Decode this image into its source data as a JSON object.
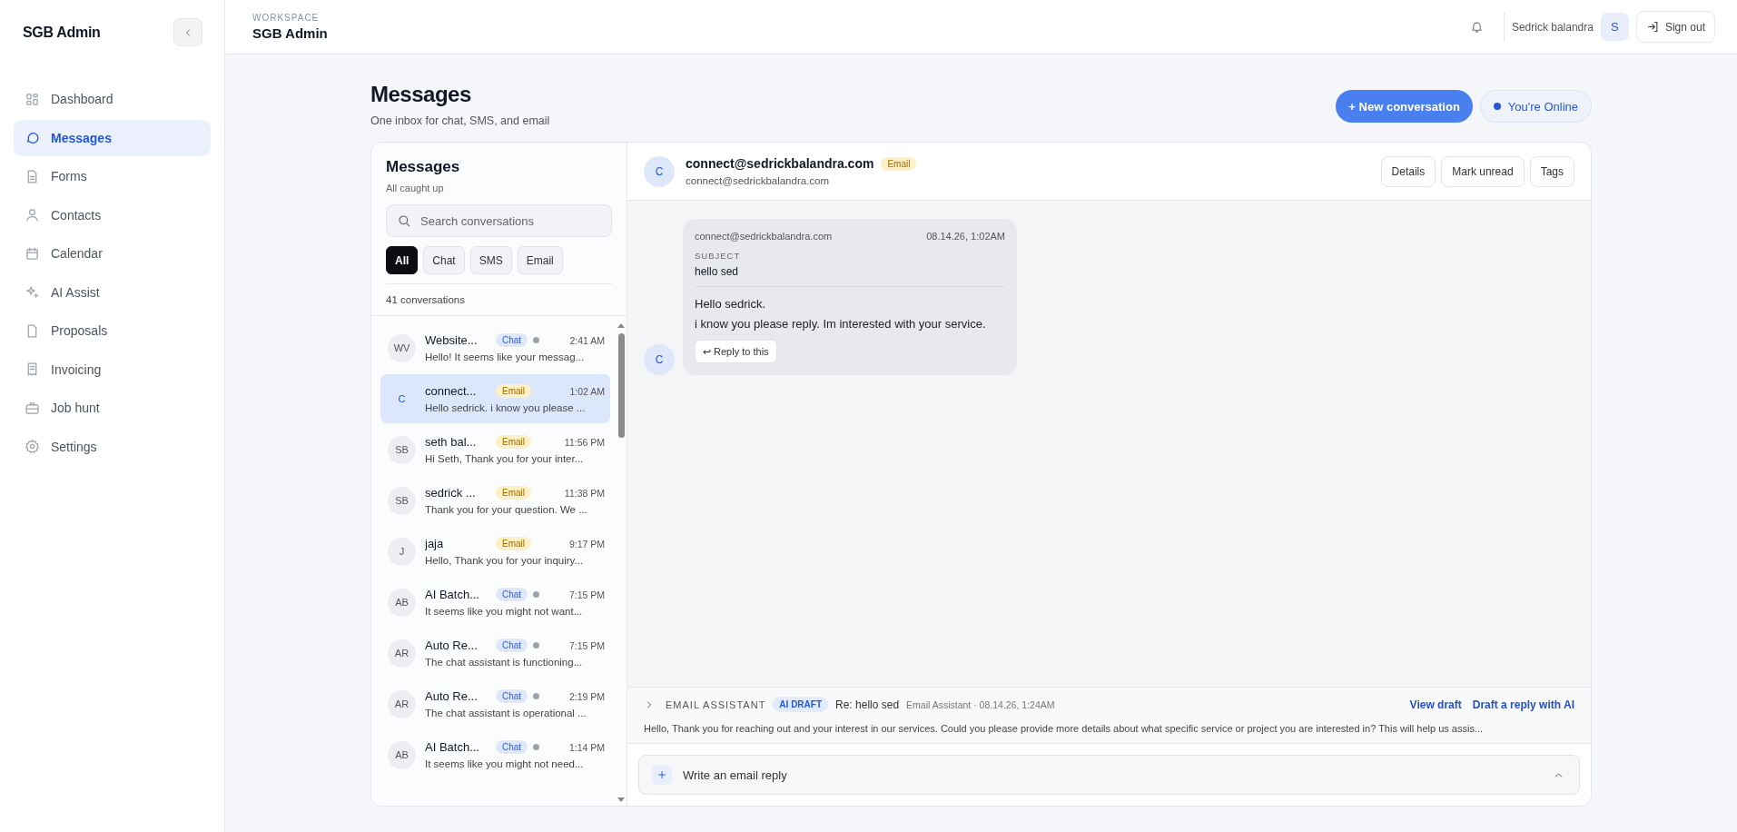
{
  "sidebar": {
    "title": "SGB Admin",
    "items": [
      {
        "label": "Dashboard",
        "selected": false
      },
      {
        "label": "Messages",
        "selected": true
      },
      {
        "label": "Forms",
        "selected": false
      },
      {
        "label": "Contacts",
        "selected": false
      },
      {
        "label": "Calendar",
        "selected": false
      },
      {
        "label": "AI Assist",
        "selected": false
      },
      {
        "label": "Proposals",
        "selected": false
      },
      {
        "label": "Invoicing",
        "selected": false
      },
      {
        "label": "Job hunt",
        "selected": false
      },
      {
        "label": "Settings",
        "selected": false
      }
    ]
  },
  "header": {
    "eyebrow": "WORKSPACE",
    "title": "SGB Admin",
    "user_name": "Sedrick balandra",
    "user_initial": "S",
    "sign_out": "Sign out"
  },
  "page": {
    "title": "Messages",
    "subtitle": "One inbox for chat, SMS, and email",
    "new_button": "+ New conversation",
    "status": "You're Online"
  },
  "inbox": {
    "title": "Messages",
    "subtitle": "All caught up",
    "search": {
      "placeholder": "Search conversations"
    },
    "filters": [
      {
        "label": "All",
        "selected": true
      },
      {
        "label": "Chat",
        "selected": false
      },
      {
        "label": "SMS",
        "selected": false
      },
      {
        "label": "Email",
        "selected": false
      }
    ],
    "count": "41 conversations",
    "conversations": [
      {
        "initials": "WV",
        "name": "Website...",
        "kind": "chat",
        "tag": "Chat",
        "unread": true,
        "time": "2:41 AM",
        "preview": "Hello! It seems like your messag...",
        "selected": false
      },
      {
        "initials": "C",
        "name": "connect...",
        "kind": "email",
        "tag": "Email",
        "unread": false,
        "time": "1:02 AM",
        "preview": "Hello sedrick. i know you please ...",
        "selected": true
      },
      {
        "initials": "SB",
        "name": "seth bal...",
        "kind": "email",
        "tag": "Email",
        "unread": false,
        "time": "11:56 PM",
        "preview": "Hi Seth, Thank you for your inter...",
        "selected": false
      },
      {
        "initials": "SB",
        "name": "sedrick ...",
        "kind": "email",
        "tag": "Email",
        "unread": false,
        "time": "11:38 PM",
        "preview": "Thank you for your question. We ...",
        "selected": false
      },
      {
        "initials": "J",
        "name": "jaja",
        "kind": "email",
        "tag": "Email",
        "unread": false,
        "time": "9:17 PM",
        "preview": "Hello, Thank you for your inquiry...",
        "selected": false
      },
      {
        "initials": "AB",
        "name": "AI Batch...",
        "kind": "chat",
        "tag": "Chat",
        "unread": true,
        "time": "7:15 PM",
        "preview": "It seems like you might not want...",
        "selected": false
      },
      {
        "initials": "AR",
        "name": "Auto Re...",
        "kind": "chat",
        "tag": "Chat",
        "unread": true,
        "time": "7:15 PM",
        "preview": "The chat assistant is functioning...",
        "selected": false
      },
      {
        "initials": "AR",
        "name": "Auto Re...",
        "kind": "chat",
        "tag": "Chat",
        "unread": true,
        "time": "2:19 PM",
        "preview": "The chat assistant is operational ...",
        "selected": false
      },
      {
        "initials": "AB",
        "name": "AI Batch...",
        "kind": "chat",
        "tag": "Chat",
        "unread": true,
        "time": "1:14 PM",
        "preview": "It seems like you might not need...",
        "selected": false
      }
    ]
  },
  "thread": {
    "initial": "C",
    "name": "connect@sedrickbalandra.com",
    "tag": "Email",
    "kind": "email",
    "address": "connect@sedrickbalandra.com",
    "actions": [
      "Details",
      "Mark unread",
      "Tags"
    ],
    "message": {
      "initial": "C",
      "from": "connect@sedrickbalandra.com",
      "time": "08.14.26, 1:02AM",
      "subject_label": "SUBJECT",
      "subject": "hello sed",
      "lines": [
        "Hello sedrick.",
        "i know you please reply. Im interested with your service."
      ],
      "reply": "↩ Reply to this"
    },
    "assistant": {
      "label": "EMAIL ASSISTANT",
      "badge": "AI DRAFT",
      "subject": "Re: hello sed",
      "meta": "Email Assistant · 08.14.26, 1:24AM",
      "links": [
        "View draft",
        "Draft a reply with AI"
      ],
      "preview": "Hello, Thank you for reaching out and your interest in our services. Could you please provide more details about what specific service or project you are interested in? This will help us assis..."
    },
    "composer": {
      "label": "Write an email reply"
    }
  }
}
